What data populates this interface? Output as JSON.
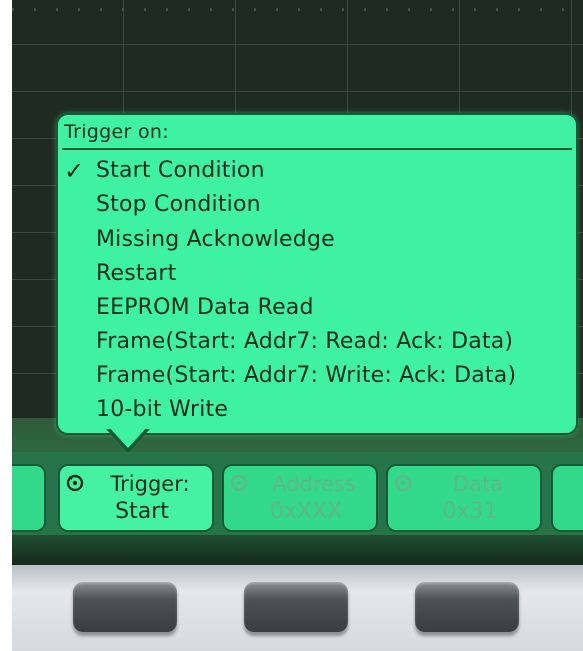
{
  "menu": {
    "title": "Trigger on:",
    "selected_marker": "✓",
    "items": [
      "Start Condition",
      "Stop Condition",
      "Missing Acknowledge",
      "Restart",
      "EEPROM Data Read",
      "Frame(Start: Addr7: Read: Ack: Data)",
      "Frame(Start: Addr7: Write: Ack: Data)",
      "10-bit Write"
    ],
    "selected_item": "Start Condition"
  },
  "softkeys": {
    "trigger": {
      "line1": "Trigger:",
      "line2": "Start",
      "icon": "rotary-knob-icon"
    },
    "address": {
      "line1": "Address",
      "line2": "0xXXX",
      "icon": "rotary-knob-icon"
    },
    "data": {
      "line1": "Data",
      "line2": "0x31",
      "icon": "rotary-knob-icon"
    }
  },
  "colors": {
    "menu_background": "#3ff2a3",
    "menu_text": "#0b2e1b",
    "softkey_background": "#33d98a",
    "screen_background": "#1b241e",
    "bezel": "#d5dade"
  }
}
